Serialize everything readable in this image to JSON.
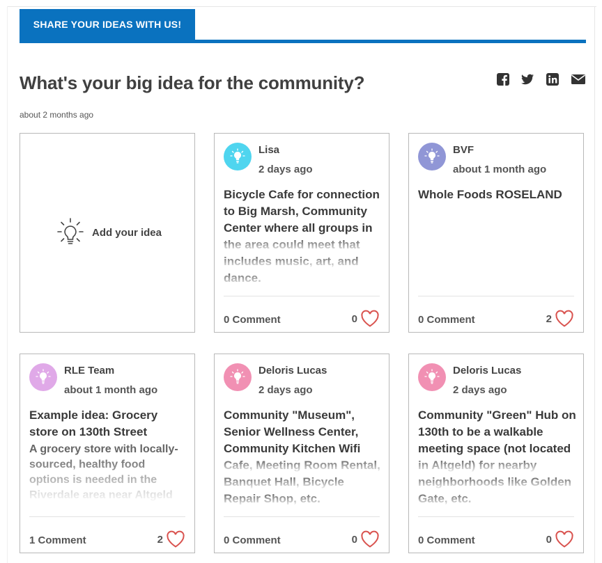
{
  "header": {
    "tab_label": "SHARE YOUR IDEAS WITH US!"
  },
  "question": {
    "title": "What's your big idea for the community?",
    "age": "about 2 months ago"
  },
  "share_icons": [
    "facebook-icon",
    "twitter-icon",
    "linkedin-icon",
    "email-icon"
  ],
  "add_idea": {
    "label": "Add your idea"
  },
  "colors": {
    "brand_blue": "#0a72bf",
    "heart": "#d9534f",
    "avatar_cyan": "#4fd5ef",
    "avatar_purple": "#9096d6",
    "avatar_lavender": "#e0a9e8",
    "avatar_pink": "#f190b3"
  },
  "ideas": [
    {
      "author": "Lisa",
      "time": "2 days ago",
      "title": "Bicycle Cafe for connection to Big Marsh, Community Center where all groups in",
      "title_fade": "the area could meet that includes music, art, and dance.",
      "description": "",
      "comments": "0 Comment",
      "likes": "0",
      "avatar_color": "#4fd5ef"
    },
    {
      "author": "BVF",
      "time": "about 1 month ago",
      "title": "Whole Foods ROSELAND",
      "title_fade": "",
      "description": "",
      "comments": "0 Comment",
      "likes": "2",
      "avatar_color": "#9096d6"
    },
    {
      "author": "RLE Team",
      "time": "about 1 month ago",
      "title": "Example idea: Grocery store on 130th Street",
      "title_fade": "",
      "description": "A grocery store with locally-sourced, healthy food options is needed in the Riverdale area near Altgeld",
      "comments": "1 Comment",
      "likes": "2",
      "avatar_color": "#e0a9e8"
    },
    {
      "author": "Deloris Lucas",
      "time": "2 days ago",
      "title": "Community \"Museum\", Senior Wellness Center, Community Kitchen Wifi",
      "title_fade": "Cafe, Meeting Room Rental, Banquet Hall, Bicycle Repair Shop, etc.",
      "description": "",
      "comments": "0 Comment",
      "likes": "0",
      "avatar_color": "#f190b3"
    },
    {
      "author": "Deloris Lucas",
      "time": "2 days ago",
      "title": "Community \"Green\" Hub on 130th to be a walkable meeting space (not located",
      "title_fade": "in Altgeld) for nearby neighborhoods like Golden Gate, etc.",
      "description": "",
      "comments": "0 Comment",
      "likes": "0",
      "avatar_color": "#f190b3"
    }
  ]
}
